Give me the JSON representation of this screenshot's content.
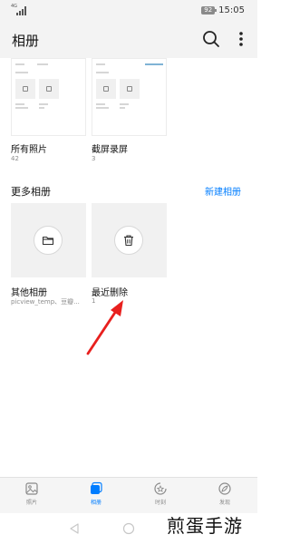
{
  "status_bar": {
    "network": "4G",
    "battery": "92",
    "time": "15:05"
  },
  "app_bar": {
    "title": "相册"
  },
  "albums": [
    {
      "name": "所有照片",
      "count": "42"
    },
    {
      "name": "截屏录屏",
      "count": "3"
    }
  ],
  "more_section": {
    "title": "更多相册",
    "action": "新建相册"
  },
  "more_albums": [
    {
      "name": "其他相册",
      "subtitle": "picview_temp、豆瓣...",
      "icon": "folder-icon"
    },
    {
      "name": "最近删除",
      "subtitle": "1",
      "icon": "trash-icon"
    }
  ],
  "annotation": {
    "color": "#e8201e",
    "icon": "red-arrow-icon"
  },
  "bottom_nav": [
    {
      "label": "照片",
      "icon": "photo-icon",
      "active": false
    },
    {
      "label": "相册",
      "icon": "album-icon",
      "active": true
    },
    {
      "label": "时刻",
      "icon": "moments-icon",
      "active": false
    },
    {
      "label": "发现",
      "icon": "discover-icon",
      "active": false
    }
  ],
  "watermark": "煎蛋手游",
  "colors": {
    "accent": "#007dff",
    "arrow": "#e8201e",
    "bar_bg": "#f3f3f3"
  }
}
